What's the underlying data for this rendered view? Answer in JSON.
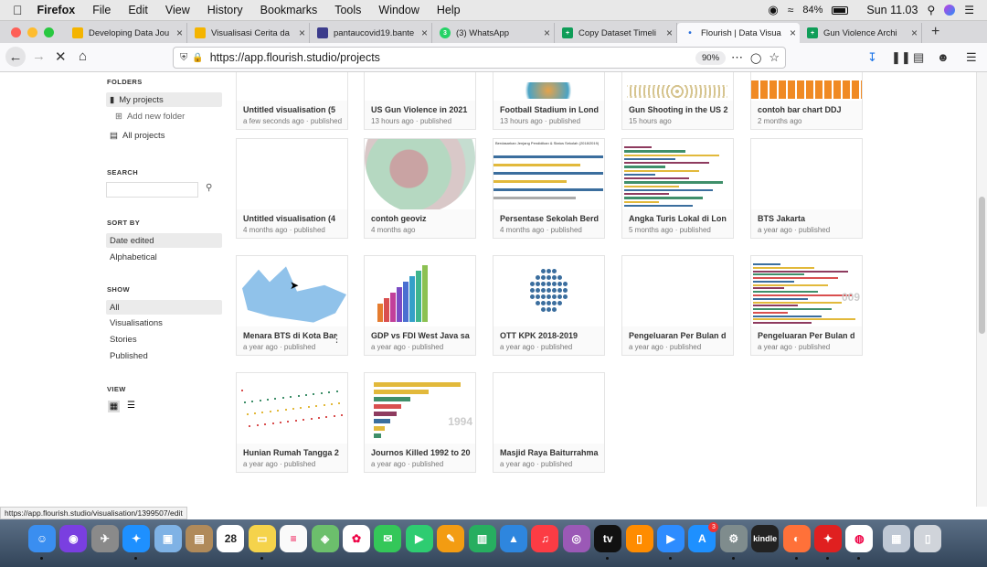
{
  "menubar": {
    "app": "Firefox",
    "items": [
      "File",
      "Edit",
      "View",
      "History",
      "Bookmarks",
      "Tools",
      "Window",
      "Help"
    ],
    "battery": "84%",
    "clock": "Sun 11.03"
  },
  "tabs": [
    {
      "title": "Developing Data Jou",
      "color": "#f4b400",
      "letter": ""
    },
    {
      "title": "Visualisasi Cerita da",
      "color": "#f4b400",
      "letter": ""
    },
    {
      "title": "pantaucovid19.bante",
      "color": "#3c3c8c",
      "letter": ""
    },
    {
      "title": "(3) WhatsApp",
      "color": "#25d366",
      "letter": "3"
    },
    {
      "title": "Copy Dataset Timeli",
      "color": "#0f9d58",
      "letter": ""
    },
    {
      "title": "Flourish | Data Visua",
      "color": "#ffffff",
      "letter": ""
    },
    {
      "title": "Gun Violence Archi",
      "color": "#0f9d58",
      "letter": ""
    }
  ],
  "navbar": {
    "url": "https://app.flourish.studio/projects",
    "zoom": "90%"
  },
  "sidebar": {
    "folders_heading": "FOLDERS",
    "my_projects": "My projects",
    "add_folder": "Add new folder",
    "all_projects": "All projects",
    "search_heading": "SEARCH",
    "search_placeholder": "",
    "sort_heading": "SORT BY",
    "sort_date": "Date edited",
    "sort_alpha": "Alphabetical",
    "show_heading": "SHOW",
    "show_all": "All",
    "show_vis": "Visualisations",
    "show_stories": "Stories",
    "show_published": "Published",
    "view_heading": "VIEW"
  },
  "cards": [
    {
      "title": "Untitled visualisation (5",
      "meta": "a few seconds ago · published"
    },
    {
      "title": "US Gun Violence in 2021",
      "meta": "13 hours ago · published"
    },
    {
      "title": "Football Stadium in Lond",
      "meta": "13 hours ago · published"
    },
    {
      "title": "Gun Shooting in the US 2",
      "meta": "15 hours ago"
    },
    {
      "title": "contoh bar chart DDJ",
      "meta": "2 months ago"
    },
    {
      "title": "Untitled visualisation (4",
      "meta": "4 months ago · published"
    },
    {
      "title": "contoh geoviz",
      "meta": "4 months ago"
    },
    {
      "title": "Persentase Sekolah Berd",
      "meta": "4 months ago · published",
      "thumbtext": "Berdasarkan Jenjang Pendidikan & Status Sekolah (2018/2019)"
    },
    {
      "title": "Angka Turis Lokal di Lon",
      "meta": "5 months ago · published"
    },
    {
      "title": "BTS Jakarta",
      "meta": "a year ago · published"
    },
    {
      "title": "Menara BTS di Kota Bar",
      "meta": "a year ago · published"
    },
    {
      "title": "GDP vs FDI West Java sa",
      "meta": "a year ago · published"
    },
    {
      "title": "OTT KPK 2018-2019",
      "meta": "a year ago · published"
    },
    {
      "title": "Pengeluaran Per Bulan d",
      "meta": "a year ago · published"
    },
    {
      "title": "Pengeluaran Per Bulan d",
      "meta": "a year ago · published",
      "thumbtext": "009"
    },
    {
      "title": "Hunian Rumah Tangga 2",
      "meta": "a year ago · published"
    },
    {
      "title": "Journos Killed 1992 to 20",
      "meta": "a year ago · published",
      "thumbtext": "1994"
    },
    {
      "title": "Masjid Raya Baiturrahma",
      "meta": "a year ago · published"
    }
  ],
  "status_url": "https://app.flourish.studio/visualisation/1399507/edit",
  "dock": {
    "calendar_day": "28",
    "badge": "3",
    "kindle": "kindle"
  }
}
